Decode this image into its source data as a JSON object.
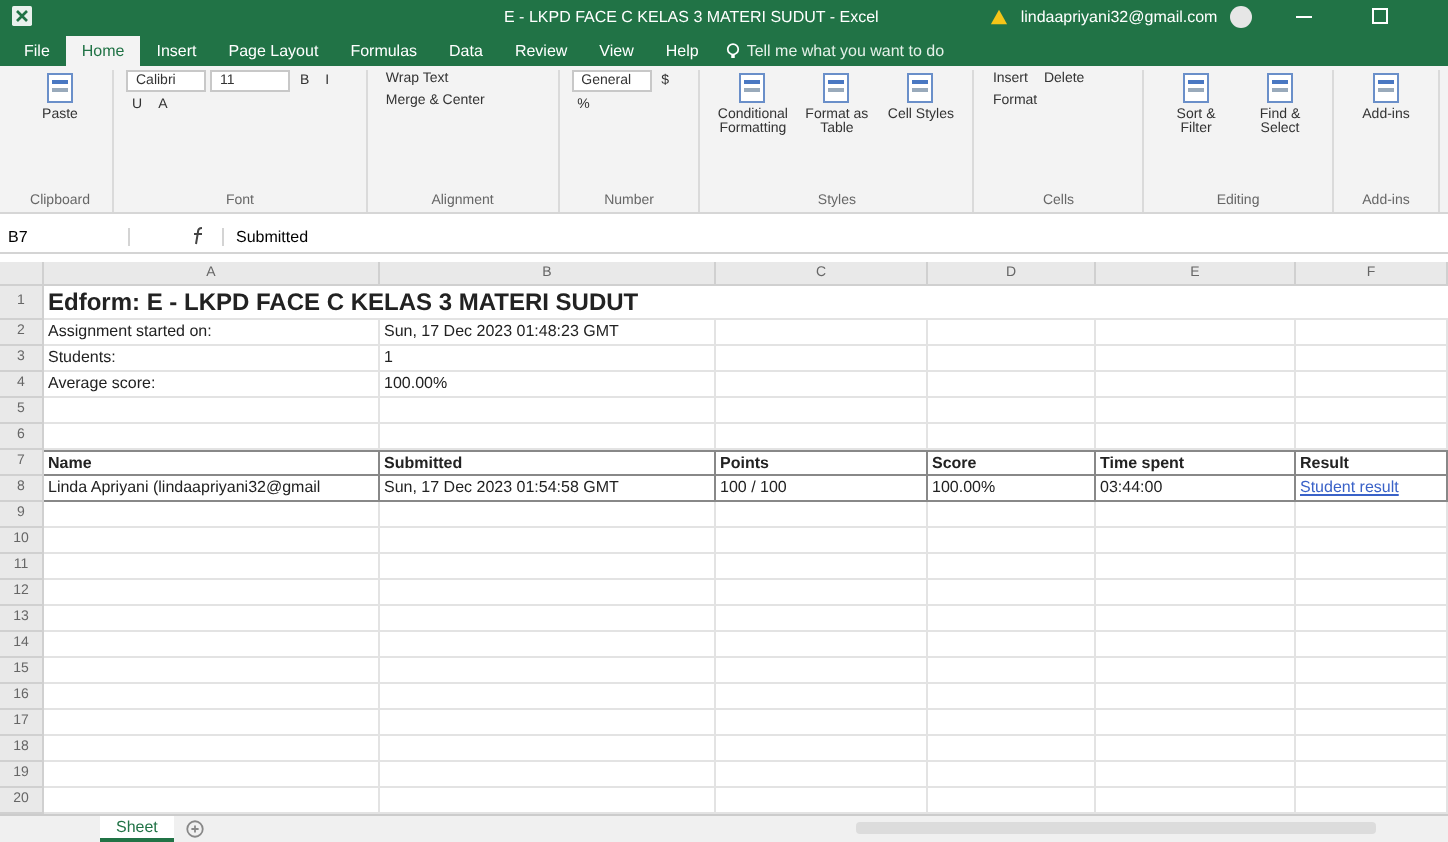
{
  "window": {
    "title": "E - LKPD FACE C KELAS 3 MATERI SUDUT - Excel",
    "account": "lindaapriyani32@gmail.com"
  },
  "tabs": [
    {
      "label": "File",
      "selected": false
    },
    {
      "label": "Home",
      "selected": true
    },
    {
      "label": "Insert",
      "selected": false
    },
    {
      "label": "Page Layout",
      "selected": false
    },
    {
      "label": "Formulas",
      "selected": false
    },
    {
      "label": "Data",
      "selected": false
    },
    {
      "label": "Review",
      "selected": false
    },
    {
      "label": "View",
      "selected": false
    },
    {
      "label": "Help",
      "selected": false
    }
  ],
  "tell_me": {
    "placeholder": "Tell me what you want to do"
  },
  "ribbon": [
    {
      "label": "Clipboard",
      "items": [
        {
          "kind": "large",
          "label": "Paste"
        }
      ]
    },
    {
      "label": "Font",
      "items": [
        {
          "kind": "field",
          "label": "Calibri"
        },
        {
          "kind": "field",
          "label": "11"
        },
        {
          "kind": "small",
          "label": "B"
        },
        {
          "kind": "small",
          "label": "I"
        },
        {
          "kind": "small",
          "label": "U"
        },
        {
          "kind": "small",
          "label": "A"
        }
      ]
    },
    {
      "label": "Alignment",
      "items": [
        {
          "kind": "small",
          "label": "Wrap Text"
        },
        {
          "kind": "small",
          "label": "Merge & Center"
        }
      ]
    },
    {
      "label": "Number",
      "items": [
        {
          "kind": "field",
          "label": "General"
        },
        {
          "kind": "small",
          "label": "$"
        },
        {
          "kind": "small",
          "label": "%"
        }
      ]
    },
    {
      "label": "Styles",
      "items": [
        {
          "kind": "large",
          "label": "Conditional Formatting"
        },
        {
          "kind": "large",
          "label": "Format as Table"
        },
        {
          "kind": "large",
          "label": "Cell Styles"
        }
      ]
    },
    {
      "label": "Cells",
      "items": [
        {
          "kind": "small",
          "label": "Insert"
        },
        {
          "kind": "small",
          "label": "Delete"
        },
        {
          "kind": "small",
          "label": "Format"
        }
      ]
    },
    {
      "label": "Editing",
      "items": [
        {
          "kind": "large",
          "label": "Sort & Filter"
        },
        {
          "kind": "large",
          "label": "Find & Select"
        }
      ]
    },
    {
      "label": "Add-ins",
      "items": [
        {
          "kind": "large",
          "label": "Add-ins"
        }
      ]
    }
  ],
  "formula_bar": {
    "name_box": "B7",
    "value": "Submitted"
  },
  "columns": [
    "A",
    "B",
    "C",
    "D",
    "E",
    "F"
  ],
  "rows": [
    {
      "num": "1",
      "kind": "title",
      "cells": [
        "Edform: E - LKPD FACE C KELAS 3 MATERI SUDUT",
        null,
        null,
        null,
        null,
        null
      ]
    },
    {
      "num": "2",
      "kind": "plain",
      "cells": [
        "Assignment started on:",
        "Sun, 17 Dec 2023 01:48:23 GMT",
        null,
        null,
        null,
        null
      ]
    },
    {
      "num": "3",
      "kind": "plain",
      "cells": [
        "Students:",
        "1",
        null,
        null,
        null,
        null
      ]
    },
    {
      "num": "4",
      "kind": "plain",
      "cells": [
        "Average score:",
        "100.00%",
        null,
        null,
        null,
        null
      ]
    },
    {
      "num": "5",
      "kind": "plain",
      "cells": [
        null,
        null,
        null,
        null,
        null,
        null
      ]
    },
    {
      "num": "6",
      "kind": "plain",
      "cells": [
        null,
        null,
        null,
        null,
        null,
        null
      ]
    },
    {
      "num": "7",
      "kind": "table_header",
      "cells": [
        "Name",
        "Submitted",
        "Points",
        "Score",
        "Time spent",
        "Result"
      ]
    },
    {
      "num": "8",
      "kind": "table_row",
      "cells": [
        "Linda Apriyani (lindaapriyani32@gmail",
        "Sun, 17 Dec 2023 01:54:58 GMT",
        "100 / 100",
        "100.00%",
        "03:44:00",
        "Student result"
      ]
    },
    {
      "num": "9",
      "kind": "plain",
      "cells": []
    },
    {
      "num": "10",
      "kind": "plain",
      "cells": []
    },
    {
      "num": "11",
      "kind": "plain",
      "cells": []
    },
    {
      "num": "12",
      "kind": "plain",
      "cells": []
    },
    {
      "num": "13",
      "kind": "plain",
      "cells": []
    },
    {
      "num": "14",
      "kind": "plain",
      "cells": []
    },
    {
      "num": "15",
      "kind": "plain",
      "cells": []
    },
    {
      "num": "16",
      "kind": "plain",
      "cells": []
    },
    {
      "num": "17",
      "kind": "plain",
      "cells": []
    },
    {
      "num": "18",
      "kind": "plain",
      "cells": []
    },
    {
      "num": "19",
      "kind": "plain",
      "cells": []
    },
    {
      "num": "20",
      "kind": "plain",
      "cells": []
    }
  ],
  "sheets": [
    {
      "label": "Sheet",
      "selected": true
    }
  ]
}
